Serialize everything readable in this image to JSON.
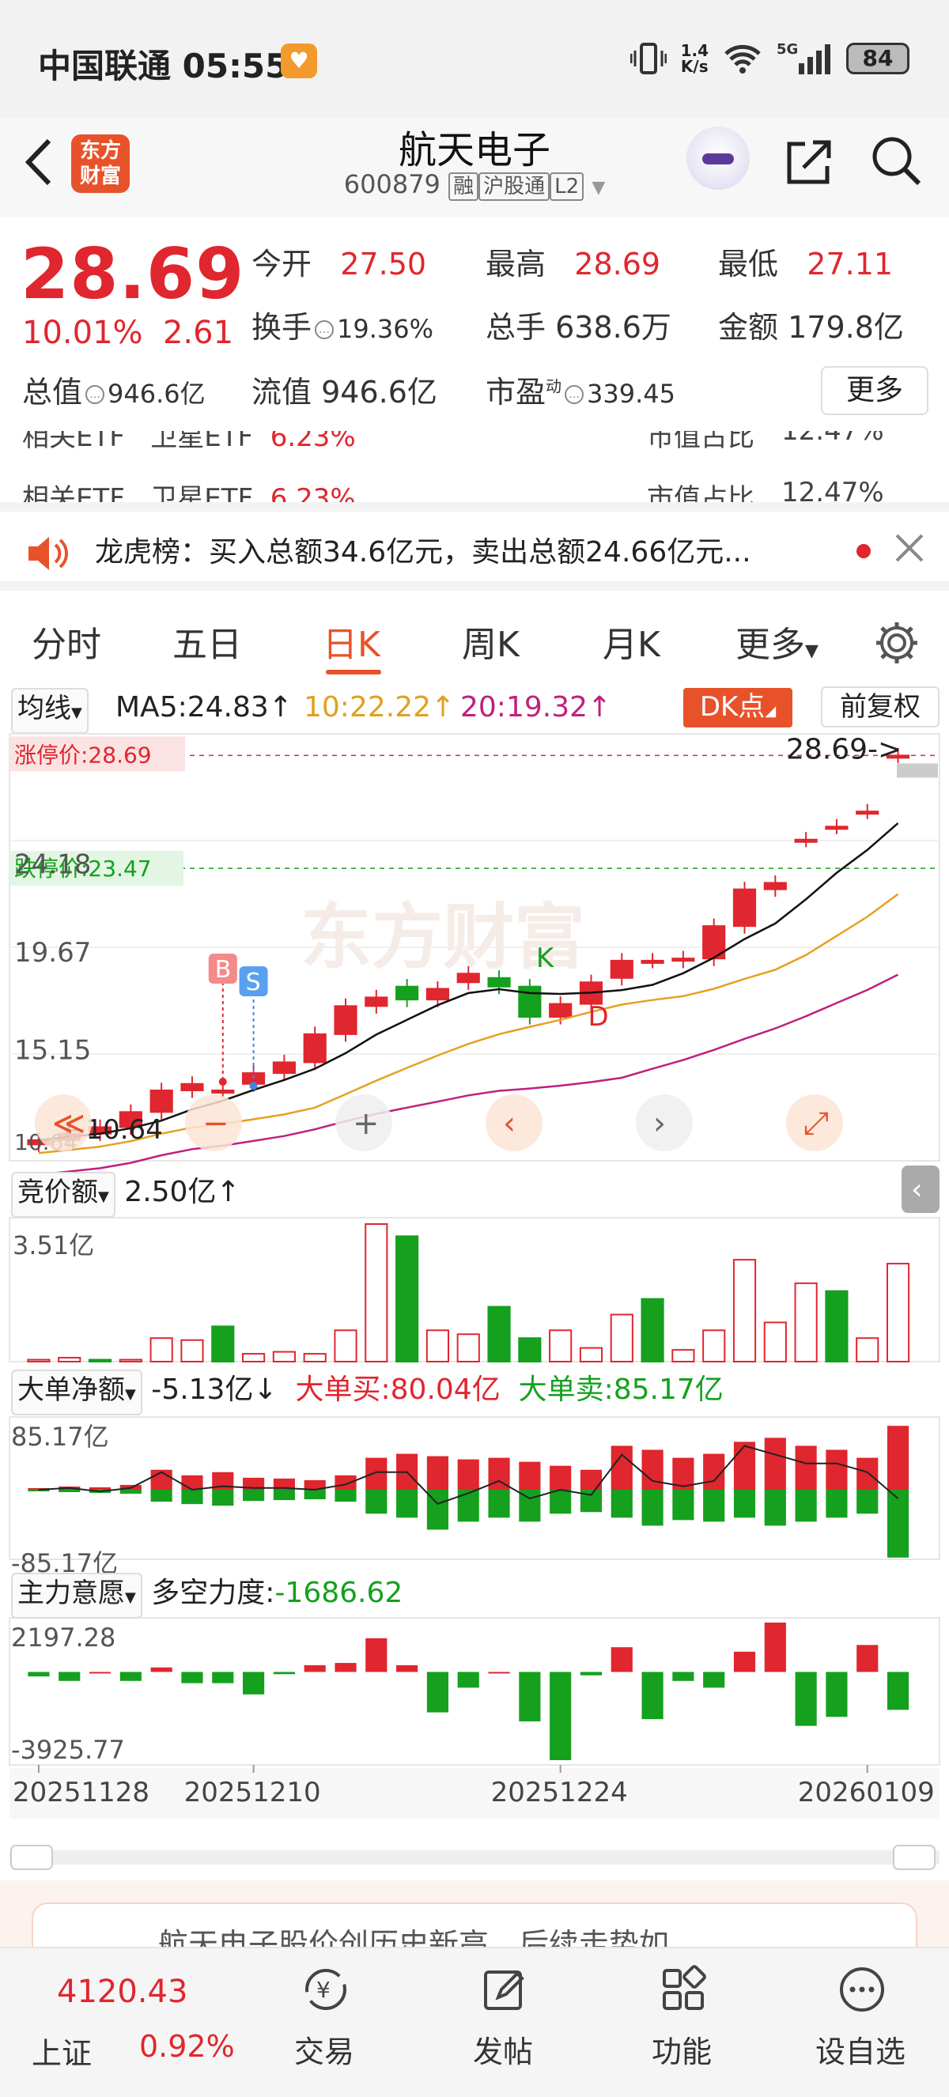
{
  "status": {
    "carrier_time": "中国联通 05:55",
    "speed_top": "1.4",
    "speed_bot": "K/s",
    "net": "5G",
    "battery": "84"
  },
  "header": {
    "logo_line1": "东方",
    "logo_line2": "财富",
    "name": "航天电子",
    "code": "600879",
    "tag1": "融",
    "tag2": "沪股通",
    "tag3": "L2"
  },
  "quote": {
    "price": "28.69",
    "pct": "10.01%",
    "chg": "2.61",
    "open_label": "今开",
    "open": "27.50",
    "high_label": "最高",
    "high": "28.69",
    "low_label": "最低",
    "low": "27.11",
    "turnover_label": "换手",
    "turnover": "19.36%",
    "vol_label": "总手",
    "vol": "638.6万",
    "amt_label": "金额",
    "amt": "179.8亿",
    "mcap_label": "总值",
    "mcap": "946.6亿",
    "float_label": "流值",
    "float": "946.6亿",
    "pe_label": "市盈",
    "pe_sup": "动",
    "pe": "339.45",
    "more": "更多"
  },
  "etf_peek": {
    "l1": "相关ETF",
    "n1": "卫星ETF",
    "p1": "6.23%",
    "r1": "市值占比",
    "rv1": "12.47%"
  },
  "notice": {
    "text": "龙虎榜：买入总额34.6亿元，卖出总额24.66亿元..."
  },
  "tabs": [
    "分时",
    "五日",
    "日K",
    "周K",
    "月K",
    "更多"
  ],
  "ma_bar": {
    "sel": "均线",
    "ma5": "MA5:24.83↑",
    "ma10": "10:22.22↑",
    "ma20": "20:19.32↑",
    "dk": "DK点",
    "fq": "前复权"
  },
  "kchart": {
    "limit_up": "涨停价:28.69",
    "limit_down": "跌停价:23.47",
    "last_label": "28.69->",
    "y_labels": [
      "24.18",
      "19.67",
      "15.15"
    ],
    "low_label": "10.64",
    "low_marker": "10.64",
    "markers": {
      "B": "B",
      "S": "S",
      "K": "K",
      "D": "D"
    },
    "watermark": "东方财富"
  },
  "chart_data": [
    {
      "type": "candlestick",
      "title": "日K",
      "dates": [
        "20251128",
        "",
        "",
        "",
        "",
        "",
        "",
        "20251210",
        "",
        "",
        "",
        "",
        "",
        "",
        "",
        "",
        "",
        "20251224",
        "",
        "",
        "",
        "",
        "",
        "",
        "",
        "",
        "",
        "20260109",
        "",
        ""
      ],
      "x_ticks": [
        "20251128",
        "20251210",
        "20251224",
        "20260109"
      ],
      "open": [
        10.7,
        10.9,
        11.2,
        11.5,
        12.2,
        13.2,
        13.2,
        13.5,
        14.0,
        14.5,
        15.8,
        17.1,
        18.0,
        17.4,
        18.2,
        18.4,
        18.0,
        16.6,
        17.2,
        18.4,
        19.2,
        19.2,
        19.3,
        20.8,
        22.5,
        24.8,
        25.4,
        26.1,
        28.69
      ],
      "close": [
        10.9,
        11.2,
        11.5,
        12.2,
        13.2,
        13.5,
        13.2,
        14.0,
        14.5,
        15.8,
        17.1,
        17.5,
        17.4,
        17.9,
        18.6,
        18.0,
        16.6,
        17.2,
        18.2,
        19.2,
        19.2,
        19.3,
        20.8,
        22.5,
        22.8,
        24.8,
        25.4,
        26.1,
        28.69
      ],
      "y_range": [
        10.64,
        28.69
      ],
      "ma_series": [
        {
          "name": "MA5",
          "value": "24.83"
        },
        {
          "name": "MA10",
          "value": "22.22"
        },
        {
          "name": "MA20",
          "value": "19.32"
        }
      ]
    },
    {
      "type": "bar",
      "title": "竞价额",
      "current": "2.50亿↑",
      "ymax_label": "3.51亿",
      "values": [
        0.05,
        0.1,
        0.05,
        0.05,
        0.6,
        0.55,
        0.9,
        0.2,
        0.25,
        0.2,
        0.8,
        3.51,
        3.2,
        0.8,
        0.7,
        1.4,
        0.6,
        0.8,
        0.35,
        1.2,
        1.6,
        0.3,
        0.8,
        2.6,
        1.0,
        2.0,
        1.8,
        0.6,
        2.5
      ],
      "colors": [
        "r",
        "r",
        "g",
        "r",
        "r",
        "r",
        "g",
        "r",
        "r",
        "r",
        "r",
        "r",
        "g",
        "r",
        "r",
        "g",
        "g",
        "r",
        "r",
        "r",
        "g",
        "r",
        "r",
        "r",
        "r",
        "r",
        "g",
        "r",
        "r"
      ]
    },
    {
      "type": "bar",
      "title": "大单净额",
      "current": "-5.13亿↓",
      "buy_label": "大单买:80.04亿",
      "sell_label": "大单卖:85.17亿",
      "ymax_label": "85.17亿",
      "ymin_label": "-85.17亿",
      "buy": [
        2,
        4,
        3,
        6,
        25,
        18,
        22,
        15,
        14,
        12,
        18,
        40,
        45,
        42,
        38,
        40,
        35,
        30,
        25,
        55,
        50,
        40,
        45,
        60,
        65,
        55,
        50,
        40,
        80
      ],
      "sell": [
        -2,
        -3,
        -4,
        -5,
        -15,
        -18,
        -20,
        -14,
        -13,
        -12,
        -15,
        -30,
        -35,
        -50,
        -40,
        -35,
        -40,
        -30,
        -28,
        -35,
        -45,
        -38,
        -40,
        -35,
        -45,
        -40,
        -35,
        -30,
        -85
      ]
    },
    {
      "type": "bar",
      "title": "主力意愿",
      "current_label": "多空力度:",
      "current": "-1686.62",
      "ymax_label": "2197.28",
      "ymin_label": "-3925.77",
      "values": [
        -200,
        -400,
        0,
        -400,
        200,
        -500,
        -500,
        -1000,
        -100,
        300,
        400,
        1500,
        300,
        -1800,
        -700,
        0,
        -2200,
        -3925.77,
        -150,
        1100,
        -2100,
        -400,
        -700,
        900,
        2197.28,
        -2400,
        -2000,
        1200,
        -1686.62
      ]
    }
  ],
  "promo": {
    "text": "航天电子股价创历史新高，后续走势如..."
  },
  "bottom": {
    "idx_val": "4120.43",
    "idx_name": "上证",
    "idx_pct": "0.92%",
    "trade": "交易",
    "post": "发帖",
    "func": "功能",
    "watch": "设自选"
  }
}
